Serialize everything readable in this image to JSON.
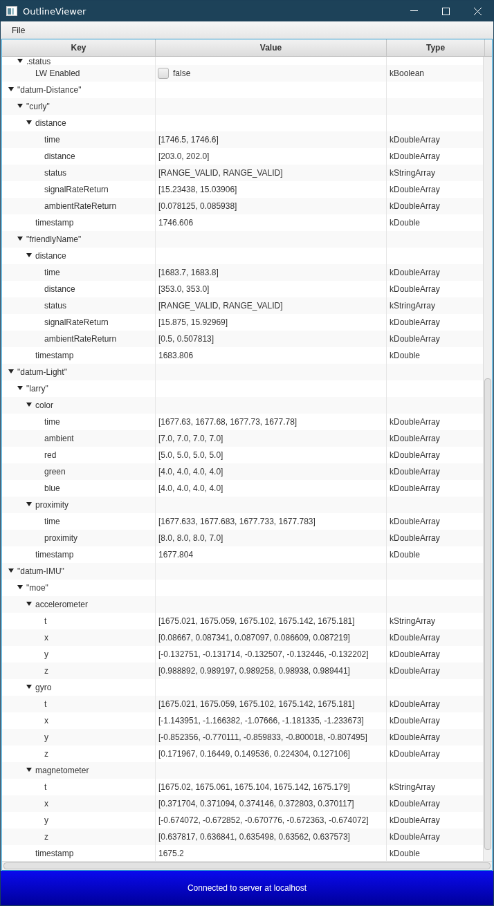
{
  "window": {
    "title": "OutlineViewer"
  },
  "menu": [
    "File"
  ],
  "table": {
    "columns": [
      "Key",
      "Value",
      "Type"
    ],
    "tree": [
      {
        "children": [
          {
            "key": ".status",
            "expanded": true,
            "children": [
              {
                "key": "LW Enabled",
                "kind": "boolean",
                "checked": false,
                "value": "false",
                "type": "kBoolean"
              }
            ]
          }
        ]
      },
      {
        "key": "\"datum-Distance\"",
        "expanded": true,
        "children": [
          {
            "key": "\"curly\"",
            "expanded": true,
            "children": [
              {
                "key": "distance",
                "expanded": true,
                "children": [
                  {
                    "key": "time",
                    "value": "[1746.5, 1746.6]",
                    "type": "kDoubleArray"
                  },
                  {
                    "key": "distance",
                    "value": "[203.0, 202.0]",
                    "type": "kDoubleArray"
                  },
                  {
                    "key": "status",
                    "value": "[RANGE_VALID, RANGE_VALID]",
                    "type": "kStringArray"
                  },
                  {
                    "key": "signalRateReturn",
                    "value": "[15.23438, 15.03906]",
                    "type": "kDoubleArray"
                  },
                  {
                    "key": "ambientRateReturn",
                    "value": "[0.078125, 0.085938]",
                    "type": "kDoubleArray"
                  }
                ]
              },
              {
                "key": "timestamp",
                "value": "1746.606",
                "type": "kDouble"
              }
            ]
          },
          {
            "key": "\"friendlyName\"",
            "expanded": true,
            "children": [
              {
                "key": "distance",
                "expanded": true,
                "children": [
                  {
                    "key": "time",
                    "value": "[1683.7, 1683.8]",
                    "type": "kDoubleArray"
                  },
                  {
                    "key": "distance",
                    "value": "[353.0, 353.0]",
                    "type": "kDoubleArray"
                  },
                  {
                    "key": "status",
                    "value": "[RANGE_VALID, RANGE_VALID]",
                    "type": "kStringArray"
                  },
                  {
                    "key": "signalRateReturn",
                    "value": "[15.875, 15.92969]",
                    "type": "kDoubleArray"
                  },
                  {
                    "key": "ambientRateReturn",
                    "value": "[0.5, 0.507813]",
                    "type": "kDoubleArray"
                  }
                ]
              },
              {
                "key": "timestamp",
                "value": "1683.806",
                "type": "kDouble"
              }
            ]
          }
        ]
      },
      {
        "key": "\"datum-Light\"",
        "expanded": true,
        "children": [
          {
            "key": "\"larry\"",
            "expanded": true,
            "children": [
              {
                "key": "color",
                "expanded": true,
                "children": [
                  {
                    "key": "time",
                    "value": "[1677.63, 1677.68, 1677.73, 1677.78]",
                    "type": "kDoubleArray"
                  },
                  {
                    "key": "ambient",
                    "value": "[7.0, 7.0, 7.0, 7.0]",
                    "type": "kDoubleArray"
                  },
                  {
                    "key": "red",
                    "value": "[5.0, 5.0, 5.0, 5.0]",
                    "type": "kDoubleArray"
                  },
                  {
                    "key": "green",
                    "value": "[4.0, 4.0, 4.0, 4.0]",
                    "type": "kDoubleArray"
                  },
                  {
                    "key": "blue",
                    "value": "[4.0, 4.0, 4.0, 4.0]",
                    "type": "kDoubleArray"
                  }
                ]
              },
              {
                "key": "proximity",
                "expanded": true,
                "children": [
                  {
                    "key": "time",
                    "value": "[1677.633, 1677.683, 1677.733, 1677.783]",
                    "type": "kDoubleArray"
                  },
                  {
                    "key": "proximity",
                    "value": "[8.0, 8.0, 8.0, 7.0]",
                    "type": "kDoubleArray"
                  }
                ]
              },
              {
                "key": "timestamp",
                "value": "1677.804",
                "type": "kDouble"
              }
            ]
          }
        ]
      },
      {
        "key": "\"datum-IMU\"",
        "expanded": true,
        "children": [
          {
            "key": "\"moe\"",
            "expanded": true,
            "children": [
              {
                "key": "accelerometer",
                "expanded": true,
                "children": [
                  {
                    "key": "t",
                    "value": "[1675.021, 1675.059, 1675.102, 1675.142, 1675.181]",
                    "type": "kStringArray"
                  },
                  {
                    "key": "x",
                    "value": "[0.08667, 0.087341, 0.087097, 0.086609, 0.087219]",
                    "type": "kDoubleArray"
                  },
                  {
                    "key": "y",
                    "value": "[-0.132751, -0.131714, -0.132507, -0.132446, -0.132202]",
                    "type": "kDoubleArray"
                  },
                  {
                    "key": "z",
                    "value": "[0.988892, 0.989197, 0.989258, 0.98938, 0.989441]",
                    "type": "kDoubleArray"
                  }
                ]
              },
              {
                "key": "gyro",
                "expanded": true,
                "children": [
                  {
                    "key": "t",
                    "value": "[1675.021, 1675.059, 1675.102, 1675.142, 1675.181]",
                    "type": "kDoubleArray"
                  },
                  {
                    "key": "x",
                    "value": "[-1.143951, -1.166382, -1.07666, -1.181335, -1.233673]",
                    "type": "kDoubleArray"
                  },
                  {
                    "key": "y",
                    "value": "[-0.852356, -0.770111, -0.859833, -0.800018, -0.807495]",
                    "type": "kDoubleArray"
                  },
                  {
                    "key": "z",
                    "value": "[0.171967, 0.16449, 0.149536, 0.224304, 0.127106]",
                    "type": "kDoubleArray"
                  }
                ]
              },
              {
                "key": "magnetometer",
                "expanded": true,
                "children": [
                  {
                    "key": "t",
                    "value": "[1675.02, 1675.061, 1675.104, 1675.142, 1675.179]",
                    "type": "kStringArray"
                  },
                  {
                    "key": "x",
                    "value": "[0.371704, 0.371094, 0.374146, 0.372803, 0.370117]",
                    "type": "kDoubleArray"
                  },
                  {
                    "key": "y",
                    "value": "[-0.674072, -0.672852, -0.670776, -0.672363, -0.674072]",
                    "type": "kDoubleArray"
                  },
                  {
                    "key": "z",
                    "value": "[0.637817, 0.636841, 0.635498, 0.63562, 0.637573]",
                    "type": "kDoubleArray"
                  }
                ]
              },
              {
                "key": "timestamp",
                "value": "1675.2",
                "type": "kDouble"
              }
            ]
          }
        ]
      }
    ]
  },
  "status_bar": {
    "text": "Connected to server at localhost"
  }
}
